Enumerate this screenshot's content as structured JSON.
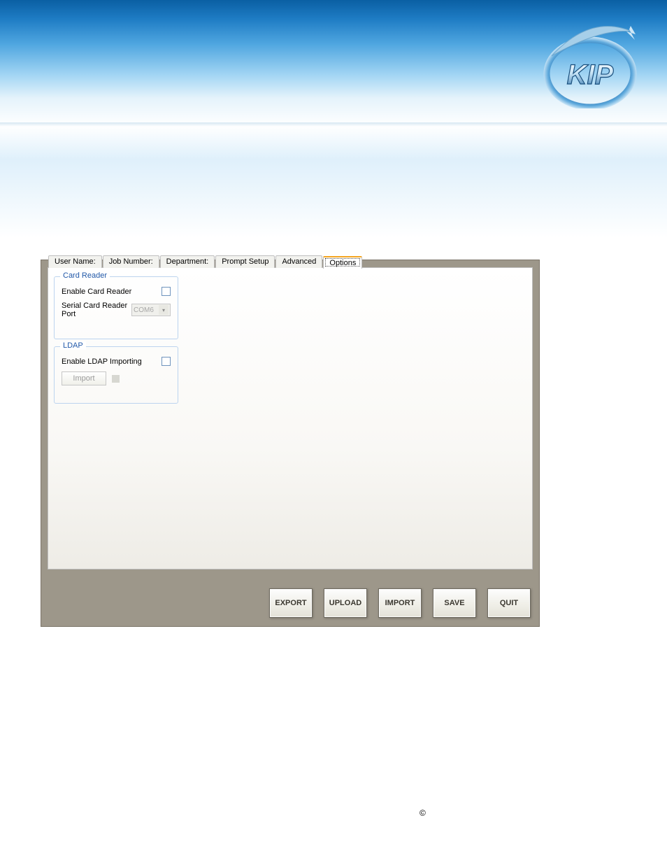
{
  "brand": {
    "name": "KIP"
  },
  "tabs": {
    "user_name": "User Name:",
    "job_number": "Job Number:",
    "department": "Department:",
    "prompt_setup": "Prompt Setup",
    "advanced": "Advanced",
    "options": "Options"
  },
  "card_reader": {
    "legend": "Card Reader",
    "enable_label": "Enable Card Reader",
    "port_label": "Serial Card Reader Port",
    "port_value": "COM6"
  },
  "ldap": {
    "legend": "LDAP",
    "enable_label": "Enable LDAP Importing",
    "import_label": "Import"
  },
  "footer": {
    "export": "EXPORT",
    "upload": "UPLOAD",
    "import": "IMPORT",
    "save": "SAVE",
    "quit": "QUIT"
  },
  "copyright_symbol": "©"
}
